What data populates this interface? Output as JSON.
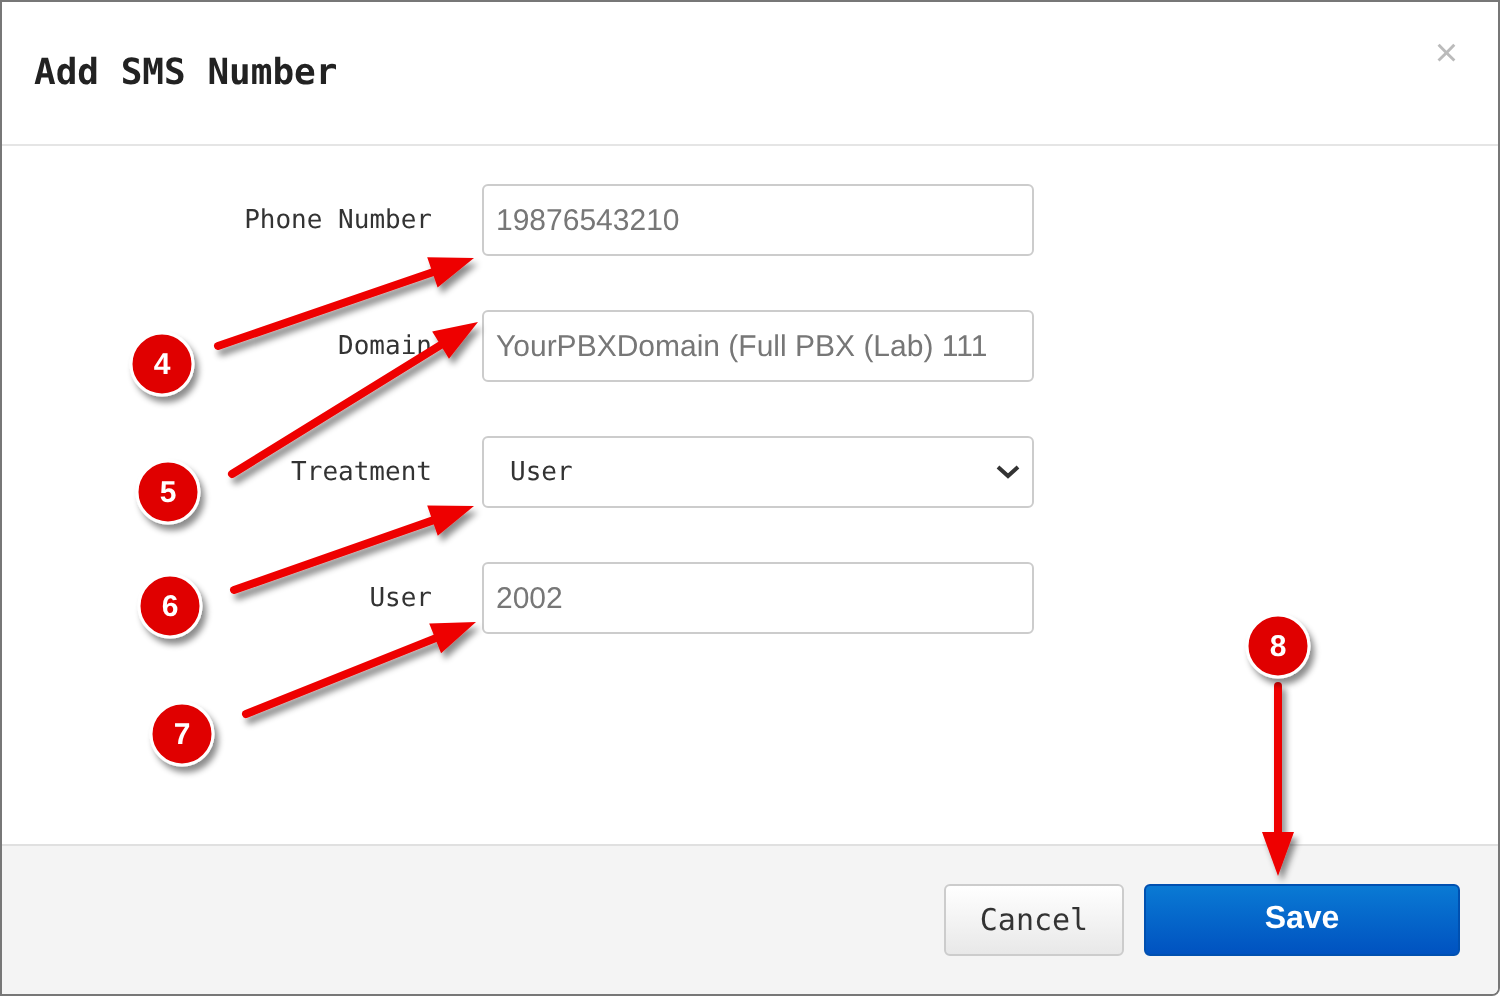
{
  "dialog": {
    "title": "Add SMS Number",
    "close": "×"
  },
  "fields": [
    {
      "label": "Phone Number",
      "kind": "text",
      "placeholder": "19876543210"
    },
    {
      "label": "Domain",
      "kind": "text",
      "placeholder": "YourPBXDomain (Full PBX (Lab) 111"
    },
    {
      "label": "Treatment",
      "kind": "select",
      "value": "User"
    },
    {
      "label": "User",
      "kind": "text",
      "placeholder": "2002"
    }
  ],
  "buttons": [
    {
      "label": "Cancel",
      "kind": "secondary"
    },
    {
      "label": "Save",
      "kind": "primary"
    }
  ],
  "callouts": [
    {
      "label": "4"
    },
    {
      "label": "5"
    },
    {
      "label": "6"
    },
    {
      "label": "7"
    },
    {
      "label": "8"
    }
  ]
}
